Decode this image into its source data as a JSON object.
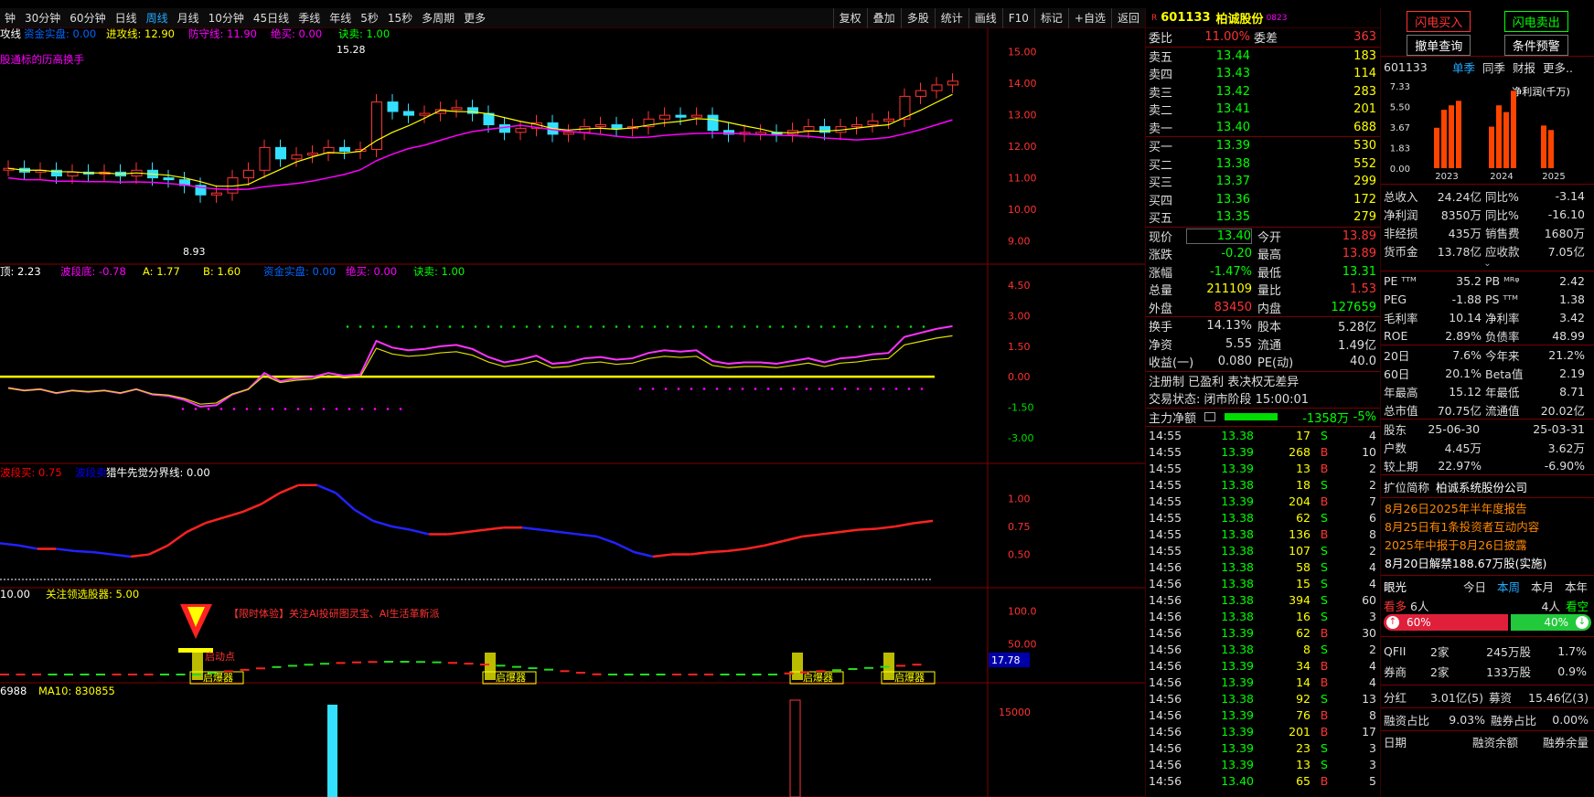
{
  "toolbar": {
    "timeframes": [
      {
        "label": "钟"
      },
      {
        "label": "30分钟"
      },
      {
        "label": "60分钟"
      },
      {
        "label": "日线"
      },
      {
        "label": "周线"
      },
      {
        "label": "月线"
      },
      {
        "label": "10分钟"
      },
      {
        "label": "45日线"
      },
      {
        "label": "季线"
      },
      {
        "label": "年线"
      },
      {
        "label": "5秒"
      },
      {
        "label": "15秒"
      },
      {
        "label": "多周期"
      },
      {
        "label": "更多"
      }
    ],
    "active_timeframe": "周线",
    "right_buttons": [
      {
        "label": "复权"
      },
      {
        "label": "叠加"
      },
      {
        "label": "多股"
      },
      {
        "label": "统计"
      },
      {
        "label": "画线"
      },
      {
        "label": "F10"
      },
      {
        "label": "标记"
      },
      {
        "label": "+自选"
      },
      {
        "label": "返回"
      }
    ]
  },
  "panes": {
    "main": {
      "legend": [
        {
          "text": "攻线",
          "color": "#ffffff"
        },
        {
          "text": "资金实盘: 0.00",
          "color": "#0066ff"
        },
        {
          "text": "进攻线: 12.90",
          "color": "#ffff00"
        },
        {
          "text": "防守线: 11.90",
          "color": "#ff00ff"
        },
        {
          "text": "绝买: 0.00",
          "color": "#ff00ff"
        },
        {
          "text": "诀卖: 1.00",
          "color": "#00ff00"
        }
      ],
      "subtitle": "股通标的历高换手",
      "subtitle_color": "#ff00ff",
      "price_labels": [
        "15.00",
        "14.00",
        "13.00",
        "12.00",
        "11.00",
        "10.00",
        "9.00"
      ],
      "high_label": "15.28",
      "low_label": "8.93"
    },
    "pane2": {
      "legend": [
        {
          "text": "顶: 2.23",
          "color": "#ffffff"
        },
        {
          "text": "波段底: -0.78",
          "color": "#ff00ff"
        },
        {
          "text": "A: 1.77",
          "color": "#ffff00"
        },
        {
          "text": "B: 1.60",
          "color": "#ffff00"
        },
        {
          "text": "资金实盘: 0.00",
          "color": "#0066ff"
        },
        {
          "text": "绝买: 0.00",
          "color": "#ff00ff"
        },
        {
          "text": "诀卖: 1.00",
          "color": "#00ff00"
        }
      ],
      "labels": [
        "4.50",
        "3.00",
        "1.50",
        "0.00",
        "-1.50",
        "-3.00"
      ]
    },
    "pane3": {
      "legend": [
        {
          "text": "波段买: 0.75",
          "color": "#ff0000"
        },
        {
          "text": "波段卖",
          "color": "#0000ff"
        },
        {
          "text": "猎牛先觉分界线: 0.00",
          "color": "#ffffff"
        }
      ],
      "labels": [
        "1.00",
        "0.75",
        "0.50"
      ]
    },
    "pane4": {
      "legend": [
        {
          "text": "10.00",
          "color": "#ffffff"
        },
        {
          "text": "关注领选股器: 5.00",
          "color": "#ffff00"
        }
      ],
      "promo": "【限时体验】关注AI投研图灵宝、AI生活革新派",
      "labels": [
        "100.0",
        "50.00"
      ],
      "current": "17.78",
      "start_point": "启动点",
      "booster": "启爆器"
    },
    "pane5": {
      "legend": [
        {
          "text": "6988",
          "color": "#ffffff"
        },
        {
          "text": "MA10: 830855",
          "color": "#ffff00"
        }
      ],
      "labels": [
        "15000"
      ]
    }
  },
  "quote": {
    "header": {
      "badge": "R",
      "code": "601133",
      "name": "柏诚股份",
      "suffix": "0823"
    },
    "weibi": {
      "label": "委比",
      "value": "11.00%",
      "label2": "委差",
      "value2": "363"
    },
    "asks": [
      {
        "label": "卖五",
        "price": "13.44",
        "vol": "183"
      },
      {
        "label": "卖四",
        "price": "13.43",
        "vol": "114"
      },
      {
        "label": "卖三",
        "price": "13.42",
        "vol": "283"
      },
      {
        "label": "卖二",
        "price": "13.41",
        "vol": "201"
      },
      {
        "label": "卖一",
        "price": "13.40",
        "vol": "688"
      }
    ],
    "bids": [
      {
        "label": "买一",
        "price": "13.39",
        "vol": "530"
      },
      {
        "label": "买二",
        "price": "13.38",
        "vol": "552"
      },
      {
        "label": "买三",
        "price": "13.37",
        "vol": "299"
      },
      {
        "label": "买四",
        "price": "13.36",
        "vol": "172"
      },
      {
        "label": "买五",
        "price": "13.35",
        "vol": "279"
      }
    ],
    "stats1": [
      {
        "l": "现价",
        "v": "13.40",
        "vc": "#00ff00",
        "l2": "今开",
        "v2": "13.89",
        "v2c": "#ff3333"
      },
      {
        "l": "涨跌",
        "v": "-0.20",
        "vc": "#00ff00",
        "l2": "最高",
        "v2": "13.89",
        "v2c": "#ff3333"
      },
      {
        "l": "涨幅",
        "v": "-1.47%",
        "vc": "#00ff00",
        "l2": "最低",
        "v2": "13.31",
        "v2c": "#00ff00"
      },
      {
        "l": "总量",
        "v": "211109",
        "vc": "#ffff00",
        "l2": "量比",
        "v2": "1.53",
        "v2c": "#ff3333"
      },
      {
        "l": "外盘",
        "v": "83450",
        "vc": "#ff3333",
        "l2": "内盘",
        "v2": "127659",
        "v2c": "#00ff00"
      }
    ],
    "stats2": [
      {
        "l": "换手",
        "v": "14.13%",
        "vc": "#dddddd",
        "l2": "股本",
        "v2": "5.28亿",
        "v2c": "#dddddd"
      },
      {
        "l": "净资",
        "v": "5.55",
        "vc": "#dddddd",
        "l2": "流通",
        "v2": "1.49亿",
        "v2c": "#dddddd"
      },
      {
        "l": "收益(一)",
        "v": "0.080",
        "vc": "#dddddd",
        "l2": "PE(动)",
        "v2": "40.0",
        "v2c": "#dddddd"
      }
    ],
    "reg": "注册制 已盈利 表决权无差异",
    "trade_status": "交易状态: 闭市阶段 15:00:01",
    "main_force": {
      "label": "主力净额",
      "value": "-1358万",
      "pct": "-5%"
    },
    "ticks": [
      {
        "t": "14:55",
        "p": "13.38",
        "v": "17",
        "d": "S",
        "n": "4"
      },
      {
        "t": "14:55",
        "p": "13.39",
        "v": "268",
        "d": "B",
        "n": "10"
      },
      {
        "t": "14:55",
        "p": "13.39",
        "v": "13",
        "d": "B",
        "n": "2"
      },
      {
        "t": "14:55",
        "p": "13.38",
        "v": "18",
        "d": "S",
        "n": "2"
      },
      {
        "t": "14:55",
        "p": "13.39",
        "v": "204",
        "d": "B",
        "n": "7"
      },
      {
        "t": "14:55",
        "p": "13.38",
        "v": "62",
        "d": "S",
        "n": "6"
      },
      {
        "t": "14:55",
        "p": "13.38",
        "v": "136",
        "d": "B",
        "n": "8"
      },
      {
        "t": "14:55",
        "p": "13.38",
        "v": "107",
        "d": "S",
        "n": "2"
      },
      {
        "t": "14:56",
        "p": "13.38",
        "v": "58",
        "d": "S",
        "n": "4"
      },
      {
        "t": "14:56",
        "p": "13.38",
        "v": "15",
        "d": "S",
        "n": "4"
      },
      {
        "t": "14:56",
        "p": "13.38",
        "v": "394",
        "d": "S",
        "n": "60"
      },
      {
        "t": "14:56",
        "p": "13.38",
        "v": "16",
        "d": "S",
        "n": "3"
      },
      {
        "t": "14:56",
        "p": "13.39",
        "v": "62",
        "d": "B",
        "n": "30"
      },
      {
        "t": "14:56",
        "p": "13.38",
        "v": "8",
        "d": "S",
        "n": "2"
      },
      {
        "t": "14:56",
        "p": "13.39",
        "v": "34",
        "d": "B",
        "n": "4"
      },
      {
        "t": "14:56",
        "p": "13.39",
        "v": "14",
        "d": "B",
        "n": "4"
      },
      {
        "t": "14:56",
        "p": "13.38",
        "v": "92",
        "d": "S",
        "n": "13"
      },
      {
        "t": "14:56",
        "p": "13.39",
        "v": "76",
        "d": "B",
        "n": "8"
      },
      {
        "t": "14:56",
        "p": "13.39",
        "v": "201",
        "d": "B",
        "n": "17"
      },
      {
        "t": "14:56",
        "p": "13.39",
        "v": "23",
        "d": "S",
        "n": "3"
      },
      {
        "t": "14:56",
        "p": "13.39",
        "v": "13",
        "d": "S",
        "n": "3"
      },
      {
        "t": "14:56",
        "p": "13.40",
        "v": "65",
        "d": "B",
        "n": "5"
      }
    ]
  },
  "side": {
    "buttons": {
      "flash_buy": "闪电买入",
      "flash_sell": "闪电卖出",
      "bulk": "撤单查询",
      "cond": "条件预警"
    },
    "fin_tabs": {
      "code": "601133",
      "t1": "单季",
      "t2": "同季",
      "t3": "财报",
      "t4": "更多.."
    },
    "fin_chart": {
      "title": "净利润(千万)",
      "y_labels": [
        "7.33",
        "5.50",
        "3.67",
        "1.83",
        "0.00"
      ],
      "x_labels": [
        "2023",
        "2024",
        "2025"
      ],
      "values": [
        3.6,
        5.2,
        5.6,
        6.0,
        3.7,
        5.6,
        5.0,
        6.9,
        3.8,
        3.4
      ]
    },
    "fin_rows": [
      {
        "l": "总收入",
        "v": "24.24亿",
        "l2": "同比%",
        "v2": "-3.14"
      },
      {
        "l": "净利润",
        "v": "8350万",
        "l2": "同比%",
        "v2": "-16.10"
      },
      {
        "l": "非经损",
        "v": "435万",
        "l2": "销售费",
        "v2": "1680万"
      },
      {
        "l": "货币金",
        "v": "13.78亿",
        "l2": "应收款",
        "v2": "7.05亿"
      }
    ],
    "val_rows": [
      {
        "l": "PE ᵀᵀᴹ",
        "v": "35.2",
        "l2": "PB ᴹᴿᵠ",
        "v2": "2.42"
      },
      {
        "l": "PEG",
        "v": "-1.88",
        "l2": "PS ᵀᵀᴹ",
        "v2": "1.38"
      },
      {
        "l": "毛利率",
        "v": "10.14",
        "l2": "净利率",
        "v2": "3.42"
      },
      {
        "l": "ROE",
        "v": "2.89%",
        "l2": "负债率",
        "v2": "48.99"
      }
    ],
    "perf_rows": [
      {
        "l": "20日",
        "v": "7.6%",
        "l2": "今年来",
        "v2": "21.2%"
      },
      {
        "l": "60日",
        "v": "20.1%",
        "l2": "Beta值",
        "v2": "2.19"
      },
      {
        "l": "年最高",
        "v": "15.12",
        "l2": "年最低",
        "v2": "8.71"
      },
      {
        "l": "总市值",
        "v": "70.75亿",
        "l2": "流通值",
        "v2": "20.02亿"
      }
    ],
    "holder_rows": [
      {
        "l": "股东",
        "v": "25-06-30",
        "v2": "25-03-31"
      },
      {
        "l": "户数",
        "v": "4.45万",
        "v2": "3.62万"
      },
      {
        "l": "较上期",
        "v": "22.97%",
        "v2": "-6.90%"
      }
    ],
    "company": {
      "label": "扩位简称",
      "value": "柏诚系统股份公司"
    },
    "news": [
      {
        "text": "8月26日2025年半年度报告",
        "color": "#ff8800"
      },
      {
        "text": "8月25日有1条投资者互动内容",
        "color": "#ff8800"
      },
      {
        "text": "2025年中报于8月26日披露",
        "color": "#ff8800"
      },
      {
        "text": "8月20日解禁188.67万股(实施)",
        "color": "#ffffff"
      }
    ],
    "sentiment": {
      "label": "眼光",
      "t1": "今日",
      "t2": "本周",
      "t3": "本月",
      "t4": "本年",
      "bull": "看多",
      "bull_n": "6人",
      "bear_n": "4人",
      "bear": "看空",
      "bull_pct": "60%",
      "bear_pct": "40%",
      "bull_frac": 0.6
    },
    "inst_rows": [
      {
        "l": "QFII",
        "n": "2家",
        "v": "245万股",
        "p": "1.7%"
      },
      {
        "l": "券商",
        "n": "2家",
        "v": "133万股",
        "p": "0.9%"
      }
    ],
    "div": {
      "l": "分红",
      "v": "3.01亿(5)",
      "l2": "募资",
      "v2": "15.46亿(3)"
    },
    "margin": {
      "l": "融资占比",
      "v": "9.03%",
      "l2": "融券占比",
      "v2": "0.00%"
    },
    "bottom": {
      "a": "日期",
      "b": "融资余额",
      "c": "融券余量"
    }
  }
}
